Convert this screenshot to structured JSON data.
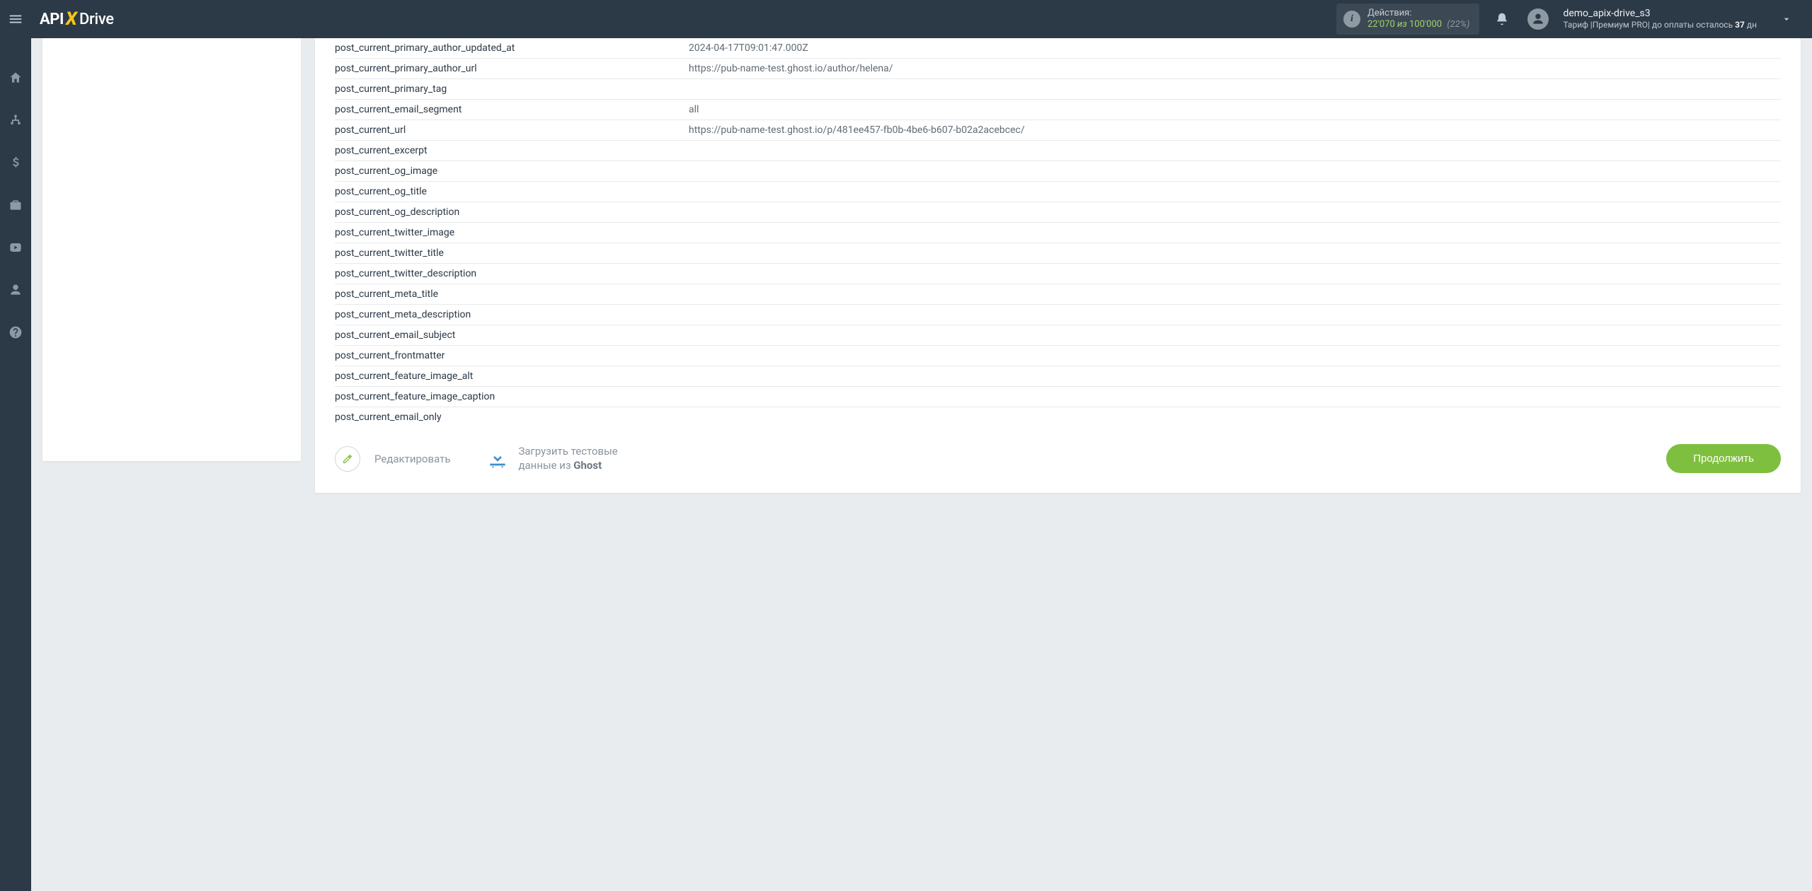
{
  "header": {
    "logo_part1": "API",
    "logo_x": "X",
    "logo_part2": "Drive",
    "actions_label": "Действия:",
    "actions_used": "22'070",
    "actions_of": "из",
    "actions_total": "100'000",
    "actions_pct": "(22%)",
    "user_name": "demo_apix-drive_s3",
    "tariff_prefix": "Тариф |",
    "tariff_plan": "Премиум PRO",
    "tariff_sep": "|  до оплаты осталось ",
    "tariff_days": "37",
    "tariff_days_suffix": " дн"
  },
  "table": {
    "rows": [
      {
        "key": "post_current_primary_author_updated_at",
        "value": "2024-04-17T09:01:47.000Z"
      },
      {
        "key": "post_current_primary_author_url",
        "value": "https://pub-name-test.ghost.io/author/helena/"
      },
      {
        "key": "post_current_primary_tag",
        "value": ""
      },
      {
        "key": "post_current_email_segment",
        "value": "all"
      },
      {
        "key": "post_current_url",
        "value": "https://pub-name-test.ghost.io/p/481ee457-fb0b-4be6-b607-b02a2acebcec/"
      },
      {
        "key": "post_current_excerpt",
        "value": ""
      },
      {
        "key": "post_current_og_image",
        "value": ""
      },
      {
        "key": "post_current_og_title",
        "value": ""
      },
      {
        "key": "post_current_og_description",
        "value": ""
      },
      {
        "key": "post_current_twitter_image",
        "value": ""
      },
      {
        "key": "post_current_twitter_title",
        "value": ""
      },
      {
        "key": "post_current_twitter_description",
        "value": ""
      },
      {
        "key": "post_current_meta_title",
        "value": ""
      },
      {
        "key": "post_current_meta_description",
        "value": ""
      },
      {
        "key": "post_current_email_subject",
        "value": ""
      },
      {
        "key": "post_current_frontmatter",
        "value": ""
      },
      {
        "key": "post_current_feature_image_alt",
        "value": ""
      },
      {
        "key": "post_current_feature_image_caption",
        "value": ""
      },
      {
        "key": "post_current_email_only",
        "value": ""
      }
    ]
  },
  "footer": {
    "edit_label": "Редактировать",
    "load_line1": "Загрузить тестовые",
    "load_line2_prefix": "данные из ",
    "load_line2_strong": "Ghost",
    "continue_label": "Продолжить"
  }
}
